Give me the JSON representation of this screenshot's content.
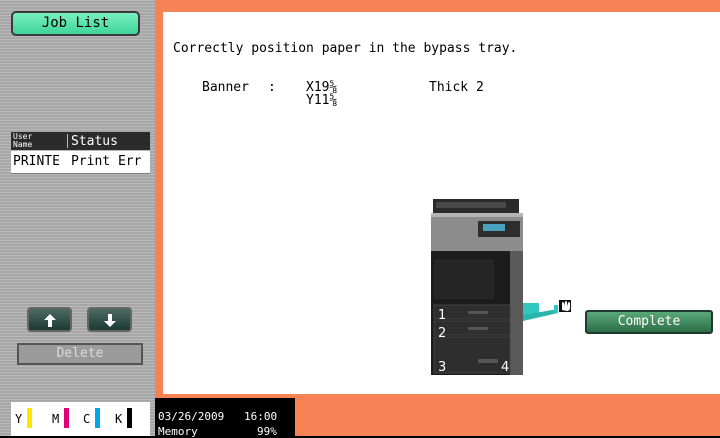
{
  "sidebar": {
    "job_list_label": "Job List",
    "headers": {
      "user_name_line1": "User",
      "user_name_line2": "Name",
      "status": "Status"
    },
    "jobs": [
      {
        "user": "PRINTE",
        "status": "Print Err"
      }
    ],
    "up_arrow_icon": "arrow-up-icon",
    "down_arrow_icon": "arrow-down-icon",
    "delete_label": "Delete",
    "toner": [
      {
        "label": "Y",
        "color": "#ffe600"
      },
      {
        "label": "M",
        "color": "#e0007a"
      },
      {
        "label": "C",
        "color": "#00a8e8"
      },
      {
        "label": "K",
        "color": "#000000"
      }
    ]
  },
  "main": {
    "message": "Correctly position paper in the bypass tray.",
    "paper": {
      "type": "Banner",
      "colon": ":",
      "width": "X19⅝",
      "height": "Y11⅝",
      "weight": "Thick 2"
    },
    "tray_numbers": [
      "1",
      "2",
      "3",
      "4"
    ],
    "bypass_icon": "hand-icon",
    "complete_label": "Complete"
  },
  "status": {
    "date": "03/26/2009",
    "time": "16:00",
    "memory_label": "Memory",
    "memory_value": "99%"
  },
  "colors": {
    "frame": "#f78255",
    "accent_button": "#3fd49a",
    "complete_button": "#2d6e47"
  }
}
